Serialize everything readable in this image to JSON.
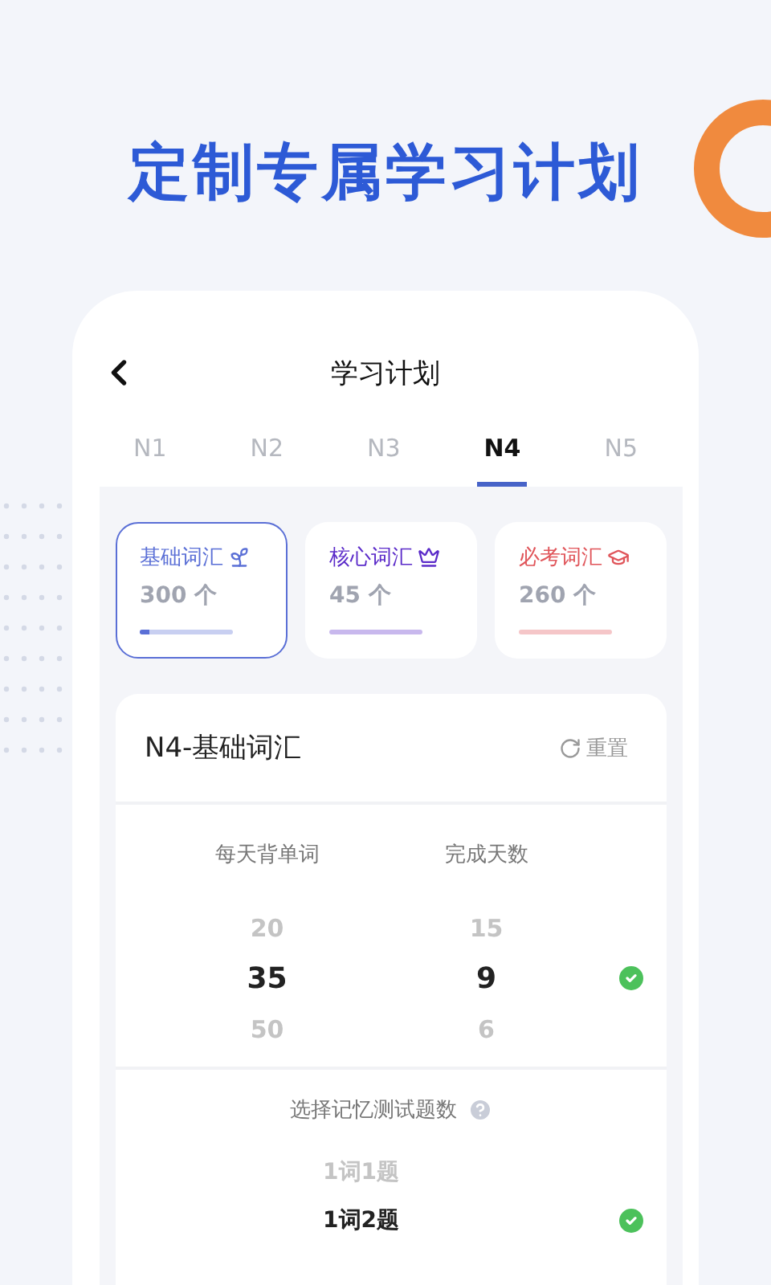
{
  "headline": "定制专属学习计划",
  "header": {
    "title": "学习计划"
  },
  "tabs": [
    {
      "label": "N1",
      "selected": false
    },
    {
      "label": "N2",
      "selected": false
    },
    {
      "label": "N3",
      "selected": false
    },
    {
      "label": "N4",
      "selected": true
    },
    {
      "label": "N5",
      "selected": false
    }
  ],
  "categories": [
    {
      "name": "基础词汇",
      "kind": "sprout",
      "count": "300 个",
      "color": "#5a6fd6",
      "level": 0.1,
      "selected": true
    },
    {
      "name": "核心词汇",
      "kind": "crown",
      "count": "45 个",
      "color": "#5b2bc9",
      "selected": false
    },
    {
      "name": "必考词汇",
      "kind": "cap",
      "count": "260 个",
      "color": "#e0555a",
      "selected": false
    }
  ],
  "plan": {
    "title": "N4-基础词汇",
    "reset": "重置",
    "pickers": [
      {
        "label": "每天背单词",
        "items": [
          {
            "value": "20",
            "selected": false
          },
          {
            "value": "35",
            "selected": true
          },
          {
            "value": "50",
            "selected": false
          }
        ]
      },
      {
        "label": "完成天数",
        "items": [
          {
            "value": "15",
            "selected": false
          },
          {
            "value": "9",
            "selected": true
          },
          {
            "value": "6",
            "selected": false
          }
        ]
      }
    ],
    "quiz": {
      "title": "选择记忆测试题数",
      "options": [
        {
          "label": "1词1题",
          "selected": false
        },
        {
          "label": "1词2题",
          "selected": true
        }
      ]
    }
  }
}
